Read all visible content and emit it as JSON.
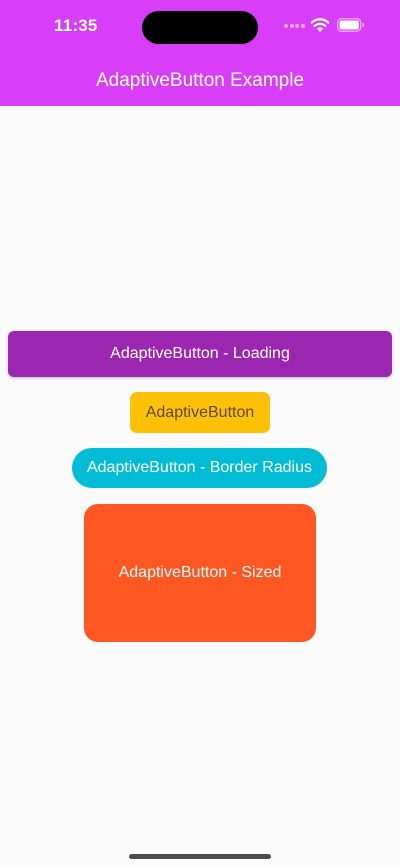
{
  "status_bar": {
    "time": "11:35"
  },
  "app_bar": {
    "title": "AdaptiveButton Example"
  },
  "buttons": [
    {
      "label": "AdaptiveButton - Loading"
    },
    {
      "label": "AdaptiveButton"
    },
    {
      "label": "AdaptiveButton - Border Radius"
    },
    {
      "label": "AdaptiveButton - Sized"
    }
  ],
  "colors": {
    "app_bar": "#d83ef7",
    "background": "#fafafa",
    "loading_button": "#9b27b0",
    "plain_button": "#ffc107",
    "radius_button": "#00bcd5",
    "sized_button": "#ff5722"
  },
  "icons": [
    "signal-icon",
    "wifi-icon",
    "battery-icon"
  ]
}
